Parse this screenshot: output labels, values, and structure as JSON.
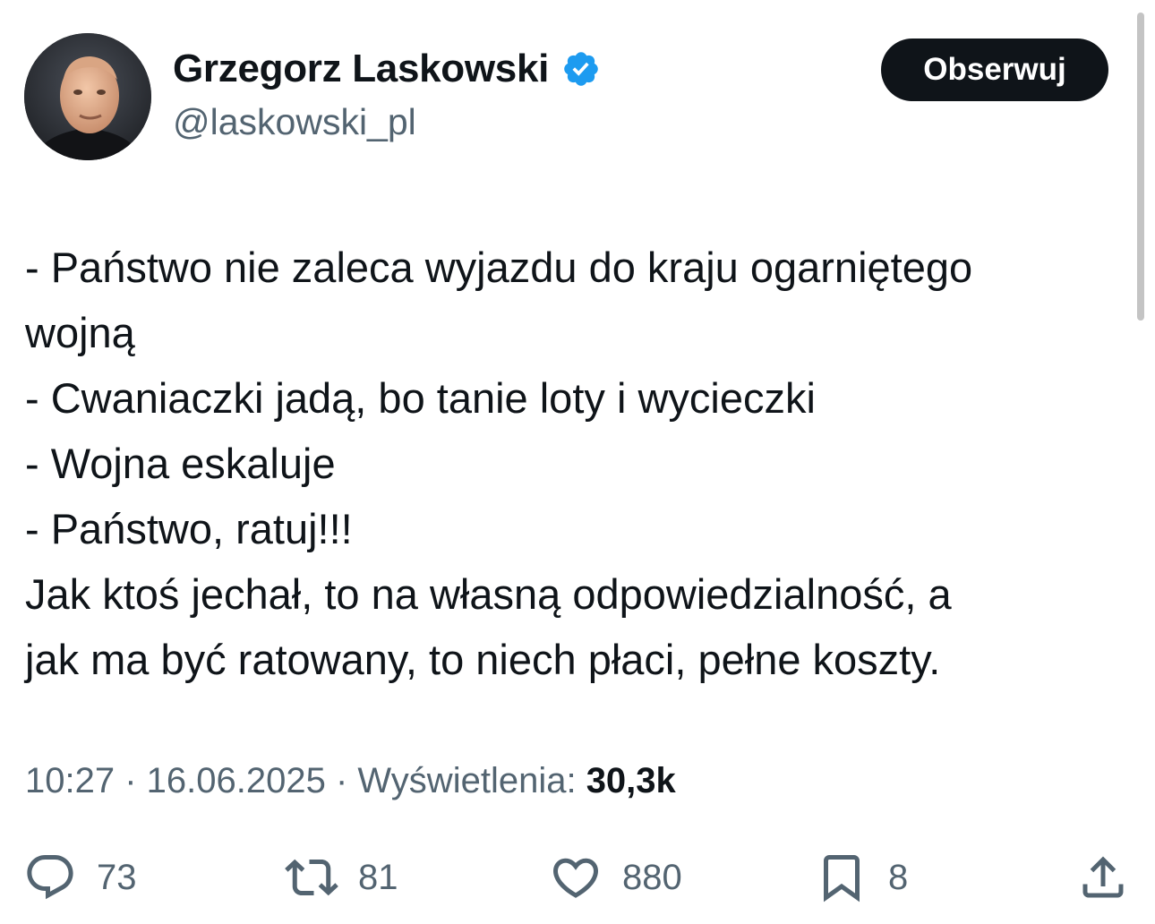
{
  "author": {
    "name": "Grzegorz Laskowski",
    "handle": "@laskowski_pl",
    "verified": true,
    "accent_color": "#1d9bf0"
  },
  "follow_button": {
    "label": "Obserwuj"
  },
  "tweet": {
    "lines": [
      "- Państwo nie zaleca wyjazdu do kraju ogarniętego",
      "wojną",
      "- Cwaniaczki jadą, bo tanie loty i wycieczki",
      "- Wojna eskaluje",
      "- Państwo, ratuj!!!",
      "Jak ktoś jechał, to na własną odpowiedzialność, a",
      "jak ma być ratowany, to niech płaci, pełne koszty."
    ]
  },
  "meta": {
    "time": "10:27",
    "sep1": " · ",
    "date": "16.06.2025",
    "sep2": " · ",
    "views_label": "Wyświetlenia: ",
    "views_count": "30,3k"
  },
  "actions": {
    "replies": {
      "icon": "reply-icon",
      "count": "73"
    },
    "reposts": {
      "icon": "repost-icon",
      "count": "81"
    },
    "likes": {
      "icon": "like-icon",
      "count": "880"
    },
    "bookmarks": {
      "icon": "bookmark-icon",
      "count": "8"
    },
    "share": {
      "icon": "share-icon"
    }
  }
}
